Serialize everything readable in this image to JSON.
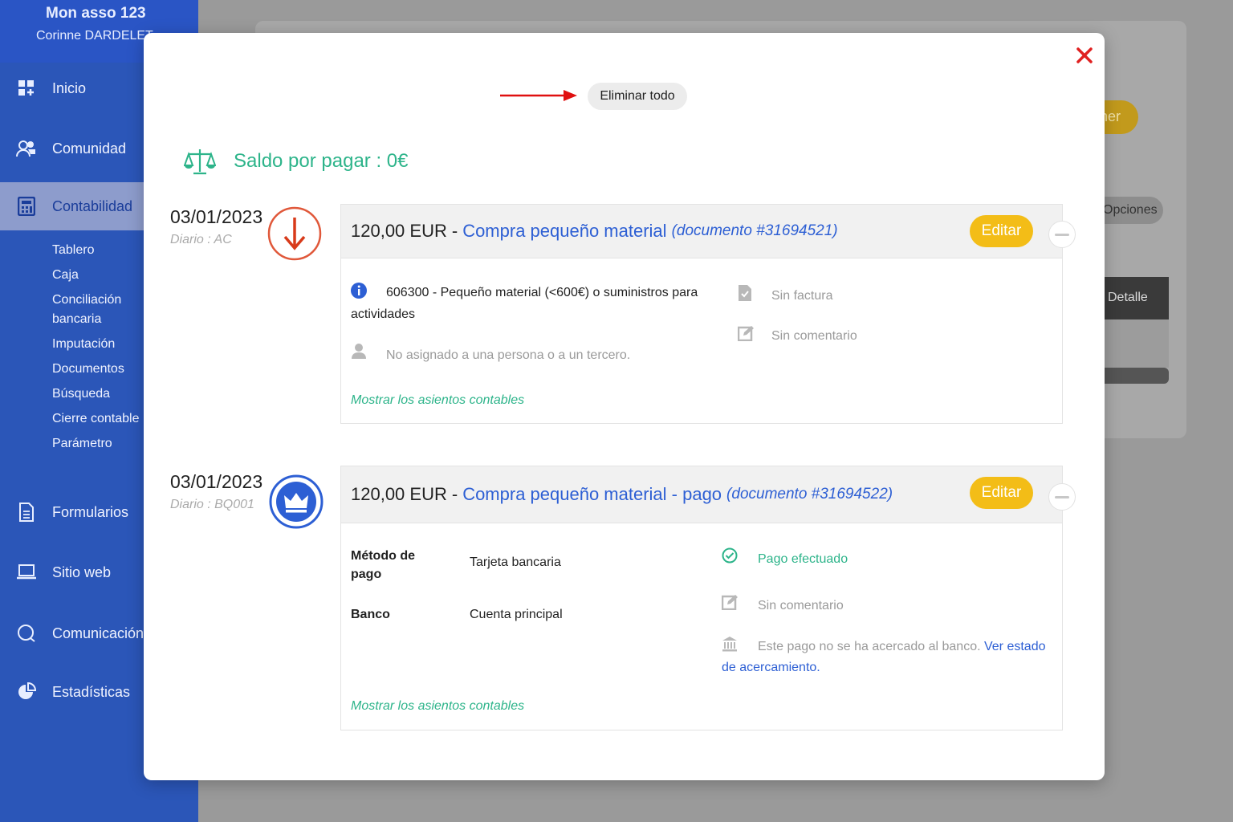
{
  "sidebar": {
    "org_name": "Mon asso 123",
    "user_name": "Corinne DARDELET",
    "items": [
      {
        "label": "Inicio",
        "icon": "dashboard-icon"
      },
      {
        "label": "Comunidad",
        "icon": "users-icon"
      },
      {
        "label": "Contabilidad",
        "icon": "calculator-icon",
        "active": true
      },
      {
        "label": "Formularios",
        "icon": "document-icon"
      },
      {
        "label": "Sitio web",
        "icon": "laptop-icon"
      },
      {
        "label": "Comunicación",
        "icon": "chat-icon"
      },
      {
        "label": "Estadísticas",
        "icon": "pie-chart-icon"
      }
    ],
    "subitems": [
      "Tablero",
      "Caja",
      "Conciliación",
      "bancaria",
      "Imputación",
      "Documentos",
      "Búsqueda",
      "Cierre contable",
      "Parámetro"
    ]
  },
  "background": {
    "yellow_button": "ner",
    "options_button": "Opciones",
    "detail_button": "Detalle"
  },
  "modal": {
    "delete_all": "Eliminar todo",
    "balance": "Saldo por pagar : 0€",
    "entries": [
      {
        "date": "03/01/2023",
        "journal": "Diario : AC",
        "amount": "120,00 EUR",
        "separator": "-",
        "title": "Compra pequeño material",
        "document": "(documento #31694521)",
        "edit_label": "Editar",
        "account_line1": "606300 - Pequeño material (<600€) o suministros para",
        "account_line2": "actividades",
        "assignment": "No asignado a una persona o a un tercero.",
        "invoice": "Sin factura",
        "comment": "Sin comentario",
        "show_entries": "Mostrar los asientos contables"
      },
      {
        "date": "03/01/2023",
        "journal": "Diario : BQ001",
        "amount": "120,00 EUR",
        "separator": "-",
        "title": "Compra pequeño material - pago",
        "document": "(documento #31694522)",
        "edit_label": "Editar",
        "method_label_1": "Método de",
        "method_label_2": "pago",
        "method_value": "Tarjeta bancaria",
        "bank_label": "Banco",
        "bank_value": "Cuenta principal",
        "payment_status": "Pago efectuado",
        "comment": "Sin comentario",
        "reconcile_text": "Este pago no se ha acercado al banco.",
        "reconcile_link_1": "Ver estado",
        "reconcile_link_2": "de acercamiento.",
        "show_entries": "Mostrar los asientos contables"
      }
    ]
  },
  "colors": {
    "accent_green": "#2db48a",
    "accent_blue": "#2d5fd4",
    "edit_yellow": "#f3bd17",
    "close_red": "#e02020"
  }
}
